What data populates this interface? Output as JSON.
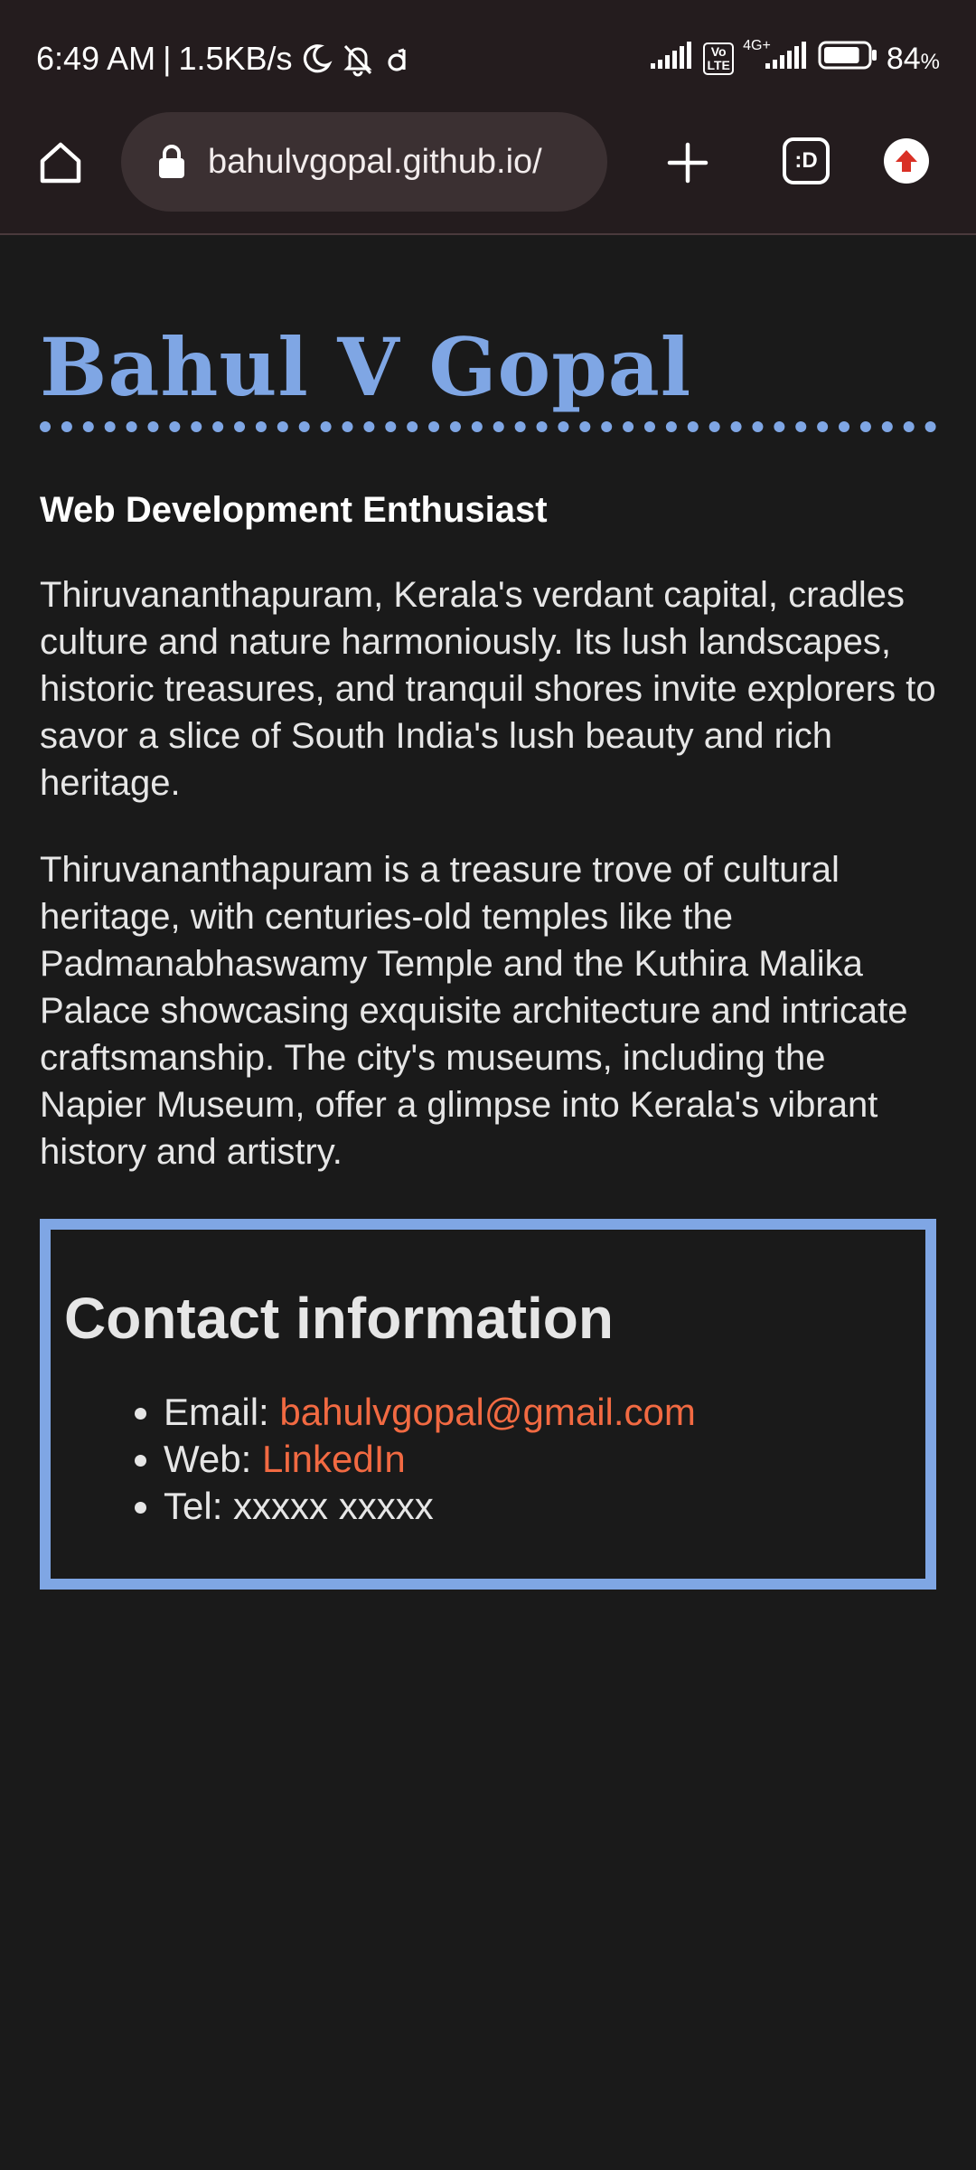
{
  "status_bar": {
    "time": "6:49 AM",
    "separator": "|",
    "net_speed": "1.5KB/s",
    "icons": [
      "moon-icon",
      "bell-off-icon",
      "d-app-icon",
      "signal-icon",
      "volte-icon",
      "signal-4g-icon",
      "battery-icon"
    ],
    "volte_label": "Vo LTE",
    "net_type": "4G+",
    "battery_percent": "84",
    "battery_level": 0.84
  },
  "browser": {
    "url": "bahulvgopal.github.io/",
    "tabs_label": ":D",
    "icons": [
      "home-icon",
      "lock-icon",
      "plus-icon",
      "tabs-icon",
      "update-icon"
    ],
    "update_color": "#d93025"
  },
  "page": {
    "title": "Bahul V Gopal",
    "subtitle": "Web Development Enthusiast",
    "paragraphs": [
      "Thiruvananthapuram, Kerala's verdant capital, cradles culture and nature harmoniously. Its lush landscapes, historic treasures, and tranquil shores invite explorers to savor a slice of South India's lush beauty and rich heritage.",
      "Thiruvananthapuram is a treasure trove of cultural heritage, with centuries-old temples like the Padmanabhaswamy Temple and the Kuthira Malika Palace showcasing exquisite architecture and intricate craftsmanship. The city's museums, including the Napier Museum, offer a glimpse into Kerala's vibrant history and artistry."
    ],
    "contact": {
      "title": "Contact information",
      "items": [
        {
          "label": "Email: ",
          "value": "bahulvgopal@gmail.com"
        },
        {
          "label": "Web: ",
          "value": "LinkedIn"
        },
        {
          "label": "Tel: ",
          "value": "xxxxx xxxxx"
        }
      ]
    }
  },
  "colors": {
    "background": "#1a1a1a",
    "accent": "#7fa6e4",
    "link": "#f26a42",
    "toolbar": "#241c1e"
  }
}
